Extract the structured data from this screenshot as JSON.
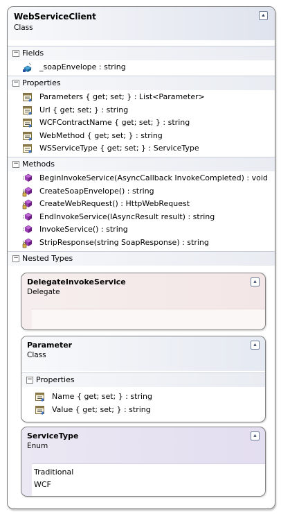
{
  "class": {
    "name": "WebServiceClient",
    "kind": "Class",
    "sections": {
      "fields": {
        "label": "Fields",
        "items": [
          "_soapEnvelope : string"
        ]
      },
      "properties": {
        "label": "Properties",
        "items": [
          "Parameters { get; set; } : List<Parameter>",
          "Url { get; set; } : string",
          "WCFContractName { get; set; } : string",
          "WebMethod { get; set; } : string",
          "WSServiceType { get; set; } : ServiceType"
        ]
      },
      "methods": {
        "label": "Methods",
        "items": [
          "BeginInvokeService(AsyncCallback InvokeCompleted) : void",
          "CreateSoapEnvelope() : string",
          "CreateWebRequest() : HttpWebRequest",
          "EndInvokeService(IAsyncResult result) : string",
          "InvokeService() : string",
          "StripResponse(string SoapResponse) : string"
        ]
      },
      "nested": {
        "label": "Nested Types"
      }
    }
  },
  "nested_types": {
    "delegate": {
      "name": "DelegateInvokeService",
      "kind": "Delegate"
    },
    "parameter": {
      "name": "Parameter",
      "kind": "Class",
      "properties_label": "Properties",
      "properties": [
        "Name { get; set; } : string",
        "Value { get; set; } : string"
      ]
    },
    "servicetype": {
      "name": "ServiceType",
      "kind": "Enum",
      "values": [
        "Traditional",
        "WCF"
      ]
    }
  },
  "icons": {
    "collapse": "double-chevron-up-icon",
    "section_toggle": "minus-box-icon",
    "field": "field-icon",
    "property": "property-icon",
    "public_method": "public-method-icon",
    "private_method": "private-method-icon"
  },
  "colors": {
    "class_header": "#e3e7ef",
    "delegate_header": "#f2e4e4",
    "enum_header": "#e7e3f1",
    "border": "#7f7f7f"
  }
}
